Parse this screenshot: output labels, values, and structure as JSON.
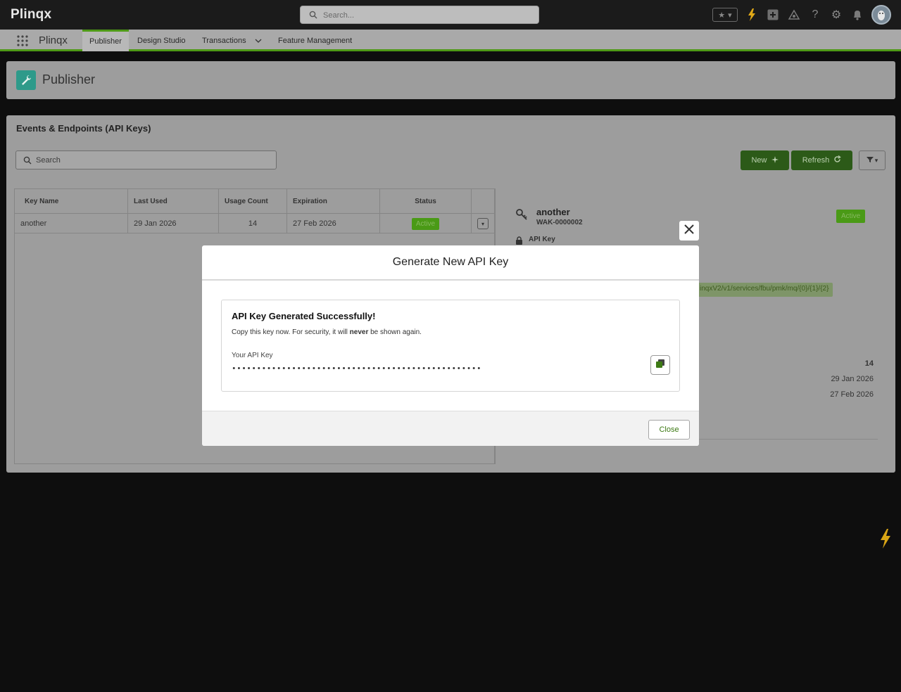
{
  "topbar": {
    "brand": "Plinqx",
    "search_placeholder": "Search..."
  },
  "nav": {
    "app_name": "Plinqx",
    "tabs": [
      {
        "label": "Publisher",
        "active": true
      },
      {
        "label": "Design Studio",
        "active": false
      },
      {
        "label": "Transactions",
        "active": false,
        "has_dropdown": true
      },
      {
        "label": "Feature Management",
        "active": false
      }
    ]
  },
  "header": {
    "title": "Publisher",
    "icon": "wrench-icon"
  },
  "section": {
    "title": "Events & Endpoints (API Keys)",
    "search_placeholder": "Search",
    "new_label": "New",
    "refresh_label": "Refresh"
  },
  "table": {
    "columns": [
      "Key Name",
      "Last Used",
      "Usage Count",
      "Expiration",
      "Status"
    ],
    "rows": [
      {
        "key_name": "another",
        "last_used": "29 Jan 2026",
        "usage_count": "14",
        "expiration": "27 Feb 2026",
        "status": "Active"
      }
    ]
  },
  "detail": {
    "name": "another",
    "id": "WAK-0000002",
    "status": "Active",
    "api_key_label": "API Key",
    "url_fragment": "inqxV2/v1/services/fbu/pmk/mq/{0}/{1}/{2}",
    "usage_count": "14",
    "last_used": "29 Jan 2026",
    "expiration": "27 Feb 2026"
  },
  "modal": {
    "title": "Generate New API Key",
    "success_title": "API Key Generated Successfully!",
    "message_before": "Copy this key now. For security, it will ",
    "message_bold": "never",
    "message_after": " be shown again.",
    "key_label": "Your API Key",
    "key_value": "••••••••••••••••••••••••••••••••••••••••••••••••••",
    "close_label": "Close"
  },
  "colors": {
    "accent_green": "#4f9a17",
    "primary_button": "#2c5a18",
    "link_green": "#3d7a14"
  }
}
